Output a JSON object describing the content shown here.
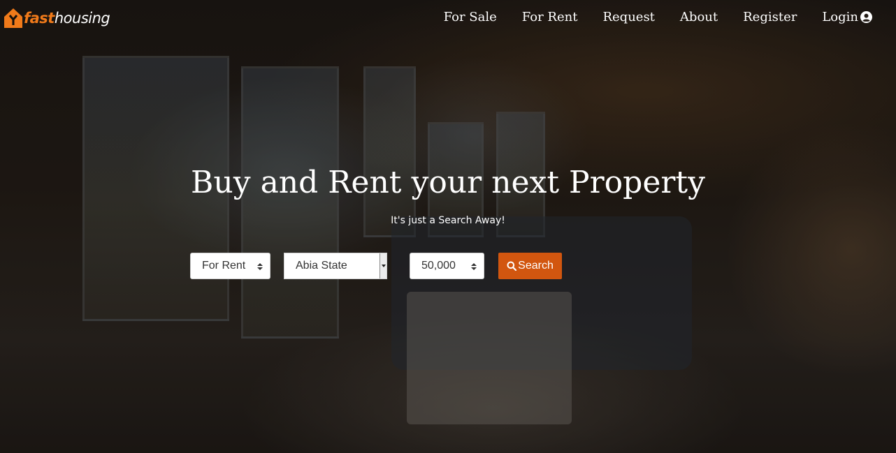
{
  "brand": {
    "name_part1": "fast",
    "name_part2": "housing",
    "logo_icon": "house-logo-icon",
    "accent_color": "#f07a1a"
  },
  "nav": {
    "items": [
      {
        "label": "For Sale"
      },
      {
        "label": "For Rent"
      },
      {
        "label": "Request"
      },
      {
        "label": "About"
      },
      {
        "label": "Register"
      },
      {
        "label": "Login",
        "icon": "user-circle-icon"
      }
    ]
  },
  "hero": {
    "title": "Buy and Rent your next Property",
    "subtitle": "It's just a Search Away!"
  },
  "search": {
    "type_select": {
      "value": "For Rent"
    },
    "state_select": {
      "value": "Abia State"
    },
    "price_select": {
      "value": "50,000"
    },
    "button_label": "Search",
    "button_icon": "search-icon",
    "button_color": "#d2560f"
  }
}
